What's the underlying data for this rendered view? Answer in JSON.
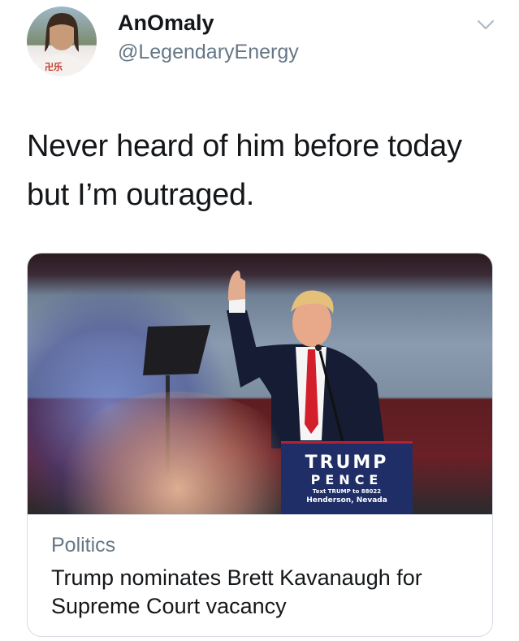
{
  "tweet": {
    "display_name": "AnOmaly",
    "handle": "@LegendaryEnergy",
    "text_line1": "Never heard of him before today",
    "text_line2": "but I’m outraged.",
    "menu_icon": "chevron-down-icon"
  },
  "card": {
    "category": "Politics",
    "title": "Trump nominates Brett Kavanaugh for Supreme Court vacancy",
    "image": {
      "sign_line1": "TRUMP",
      "sign_line2": "PENCE",
      "sign_line3": "Text TRUMP to 88022",
      "sign_line4": "Henderson, Nevada"
    }
  },
  "colors": {
    "text_primary": "#14171a",
    "text_secondary": "#657786",
    "card_border": "#d6dde3",
    "sign_blue": "#1f2e66",
    "sign_red": "#b22234"
  }
}
